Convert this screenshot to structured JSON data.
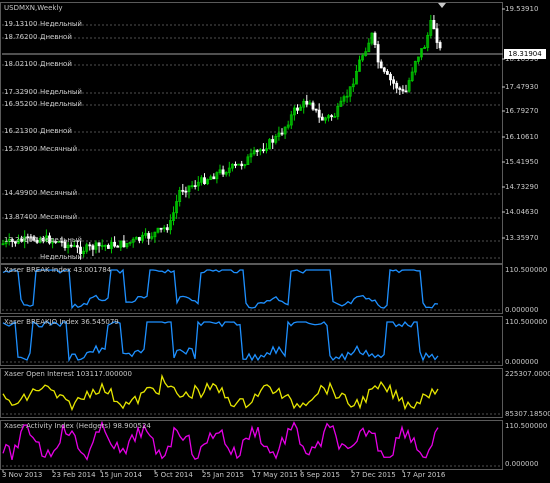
{
  "window": {
    "symbol_title": "USDMXN,Weekly",
    "current_price": "18.31904"
  },
  "level_lines": [
    {
      "value": "19.13100",
      "label": "Недельный"
    },
    {
      "value": "18.76200",
      "label": "Дневной"
    },
    {
      "value": "18.02100",
      "label": "Дневной"
    },
    {
      "value": "17.32900",
      "label": "Недельный"
    },
    {
      "value": "16.95200",
      "label": "Недельный"
    },
    {
      "value": "16.21300",
      "label": "Дневной"
    },
    {
      "value": "15.73900",
      "label": "Месячный"
    },
    {
      "value": "14.49900",
      "label": "Месячный"
    },
    {
      "value": "13.87400",
      "label": "Месячный"
    },
    {
      "value": "13.20600",
      "label": "Недельный"
    },
    {
      "value": "",
      "label": "Недельный"
    }
  ],
  "price_axis": [
    "19.53910",
    "18.16590",
    "17.47930",
    "16.79270",
    "16.10610",
    "15.41950",
    "14.73290",
    "14.04630",
    "13.35970"
  ],
  "indicators": [
    {
      "title": "Xaser BREAK Index 43.001784",
      "axis": [
        "110.500000",
        "0.000000"
      ],
      "color": "#1e90ff"
    },
    {
      "title": "Xaser BREAKJO Index 36.545079",
      "axis": [
        "110.500000",
        "0.000000"
      ],
      "color": "#1e90ff"
    },
    {
      "title": "Xaser Open Interest 103117.000000",
      "axis": [
        "225307.000000",
        "85307.185000"
      ],
      "color": "#e6e600"
    },
    {
      "title": "Xaser Activity Index (Hedgers) 98.900524",
      "axis": [
        "110.500000",
        "0.000000"
      ],
      "color": "#e600e6"
    }
  ],
  "time_axis": [
    "3 Nov 2013",
    "23 Feb 2014",
    "15 Jun 2014",
    "5 Oct 2014",
    "25 Jan 2015",
    "17 May 2015",
    "6 Sep 2015",
    "27 Dec 2015",
    "17 Apr 2016"
  ],
  "colors": {
    "bull": "#00c800",
    "bear": "#ffffff",
    "grid": "#505050",
    "frame": "#5a5a5a"
  }
}
